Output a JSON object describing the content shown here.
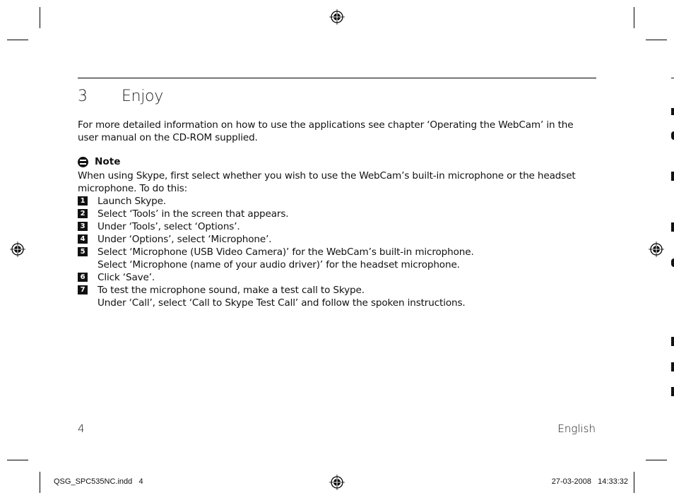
{
  "chapter": {
    "number": "3",
    "title": "Enjoy"
  },
  "intro": "For more detailed information on how to use the applications see chapter ‘Operating the WebCam’ in the user manual on the CD-ROM supplied.",
  "note": {
    "icon": "note-icon",
    "heading": "Note",
    "body": "When using Skype, first select whether you wish to use the WebCam’s built-in microphone or the headset microphone. To do this:"
  },
  "steps": [
    {
      "num": "1",
      "lines": [
        "Launch Skype."
      ]
    },
    {
      "num": "2",
      "lines": [
        "Select ‘Tools’ in the screen that appears."
      ]
    },
    {
      "num": "3",
      "lines": [
        "Under ‘Tools’, select ‘Options’."
      ]
    },
    {
      "num": "4",
      "lines": [
        "Under ‘Options’, select ‘Microphone’."
      ]
    },
    {
      "num": "5",
      "lines": [
        "Select ‘Microphone (USB Video Camera)’ for the WebCam’s built-in microphone.",
        "Select ‘Microphone (name of your audio driver)’ for the headset microphone."
      ]
    },
    {
      "num": "6",
      "lines": [
        "Click ‘Save’."
      ]
    },
    {
      "num": "7",
      "lines": [
        "To test the microphone sound, make a test call to Skype.",
        "Under ‘Call’, select ‘Call to Skype Test Call’ and follow the spoken instructions."
      ]
    }
  ],
  "footer": {
    "page_number": "4",
    "language": "English"
  },
  "slug": {
    "file": "QSG_SPC535NC.indd   4",
    "datetime": "27-03-2008   14:33:32"
  },
  "icons": {
    "registration": "registration-mark-icon"
  }
}
